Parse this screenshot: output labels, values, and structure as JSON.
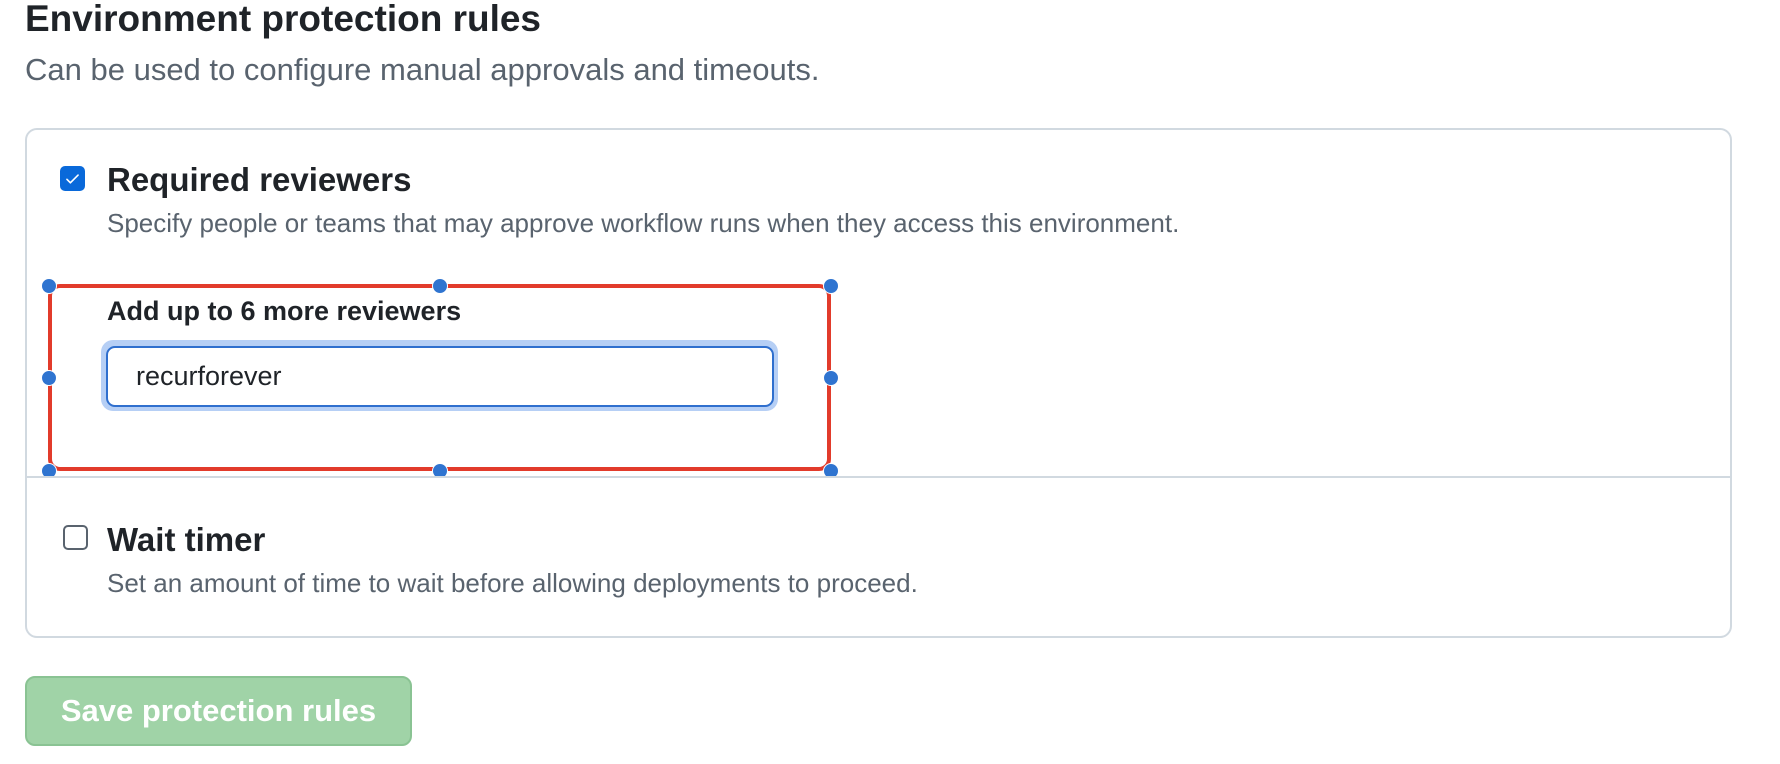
{
  "header": {
    "title": "Environment protection rules",
    "description": "Can be used to configure manual approvals and timeouts."
  },
  "rules": {
    "required_reviewers": {
      "checked": true,
      "title": "Required reviewers",
      "description": "Specify people or teams that may approve workflow runs when they access this environment.",
      "add_label": "Add up to 6 more reviewers",
      "input_value": "recurforever"
    },
    "wait_timer": {
      "checked": false,
      "title": "Wait timer",
      "description": "Set an amount of time to wait before allowing deployments to proceed."
    }
  },
  "actions": {
    "save_label": "Save protection rules",
    "save_disabled": true
  },
  "colors": {
    "checkbox_checked": "#0969da",
    "selection_frame": "#e23b2b",
    "selection_handles": "#2f74d0",
    "save_button_disabled": "#a0d3a7"
  },
  "icons": {
    "checkmark": "check-icon"
  }
}
